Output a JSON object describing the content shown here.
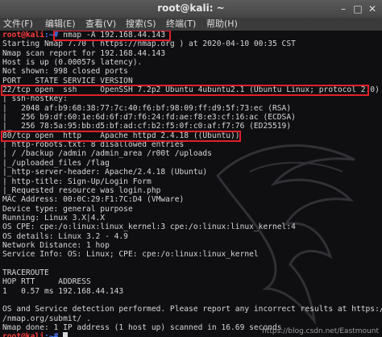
{
  "window": {
    "title": "root@kali: ~",
    "minimize_glyph": "–",
    "maximize_glyph": "□",
    "close_glyph": "✕"
  },
  "menu": [
    "文件(F)",
    "编辑(E)",
    "查看(V)",
    "搜索(S)",
    "终端(T)",
    "帮助(H)"
  ],
  "prompt": {
    "user": "root@kali",
    "dir": ":~#",
    "dir2": ":~# "
  },
  "command": " nmap -A 192.168.44.143",
  "lines": [
    "Starting Nmap 7.70 ( https://nmap.org ) at 2020-04-10 00:35 CST",
    "Nmap scan report for 192.168.44.143",
    "Host is up (0.00057s latency).",
    "Not shown: 998 closed ports",
    "PORT   STATE SERVICE VERSION",
    "22/tcp open  ssh     OpenSSH 7.2p2 Ubuntu 4ubuntu2.1 (Ubuntu Linux; protocol 2.0)",
    "| ssh-hostkey:",
    "|   2048 af:b9:68:38:77:7c:40:f6:bf:98:09:ff:d9:5f:73:ec (RSA)",
    "|   256 b9:df:60:1e:6d:6f:d7:f6:24:fd:ae:f8:e3:cf:16:ac (ECDSA)",
    "|_  256 78:5a:95:bb:d5:bf:ad:cf:b2:f5:0f:c0:af:f7:76 (ED25519)",
    "80/tcp open  http    Apache httpd 2.4.18 ((Ubuntu))",
    "| http-robots.txt: 8 disallowed entries",
    "| / /backup /admin /admin_area /r00t /uploads",
    "|_/uploaded_files /flag",
    "|_http-server-header: Apache/2.4.18 (Ubuntu)",
    "| http-title: Sign-Up/Login Form",
    "|_Requested resource was login.php",
    "MAC Address: 00:0C:29:F1:7C:D4 (VMware)",
    "Device type: general purpose",
    "Running: Linux 3.X|4.X",
    "OS CPE: cpe:/o:linux:linux_kernel:3 cpe:/o:linux:linux_kernel:4",
    "OS details: Linux 3.2 - 4.9",
    "Network Distance: 1 hop",
    "Service Info: OS: Linux; CPE: cpe:/o:linux:linux_kernel",
    "",
    "TRACEROUTE",
    "HOP RTT     ADDRESS",
    "1   0.57 ms 192.168.44.143",
    "",
    "OS and Service detection performed. Please report any incorrect results at https:/",
    "/nmap.org/submit/ .",
    "Nmap done: 1 IP address (1 host up) scanned in 16.69 seconds"
  ],
  "watermark": "https://blog.csdn.net/Eastmount"
}
